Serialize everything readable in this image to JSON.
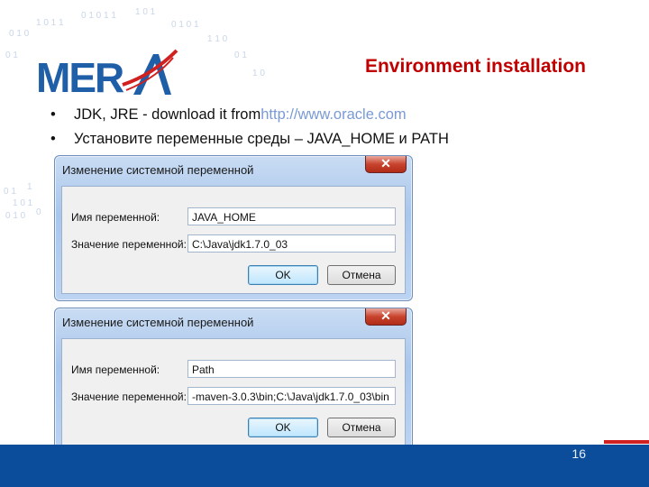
{
  "slide": {
    "title": "Environment installation",
    "logo_text": "MERA",
    "bullets": [
      {
        "text": "JDK, JRE - download it from ",
        "link": "http://www.oracle.com"
      },
      {
        "text": "Установите переменные среды – JAVA_HOME и PATH",
        "link": ""
      }
    ],
    "page_number": "16"
  },
  "dialogs": [
    {
      "title": "Изменение системной переменной",
      "close_label": "✕",
      "name_label": "Имя переменной:",
      "value_label": "Значение переменной:",
      "name_value": "JAVA_HOME",
      "value_value": "C:\\Java\\jdk1.7.0_03",
      "ok_label": "OK",
      "cancel_label": "Отмена"
    },
    {
      "title": "Изменение системной переменной",
      "close_label": "✕",
      "name_label": "Имя переменной:",
      "value_label": "Значение переменной:",
      "name_value": "Path",
      "value_value": "-maven-3.0.3\\bin;C:\\Java\\jdk1.7.0_03\\bin",
      "ok_label": "OK",
      "cancel_label": "Отмена"
    }
  ],
  "colors": {
    "title": "#c00000",
    "footer": "#0b4d9a",
    "logo_blue": "#1f5fa8",
    "logo_red": "#d02020"
  }
}
